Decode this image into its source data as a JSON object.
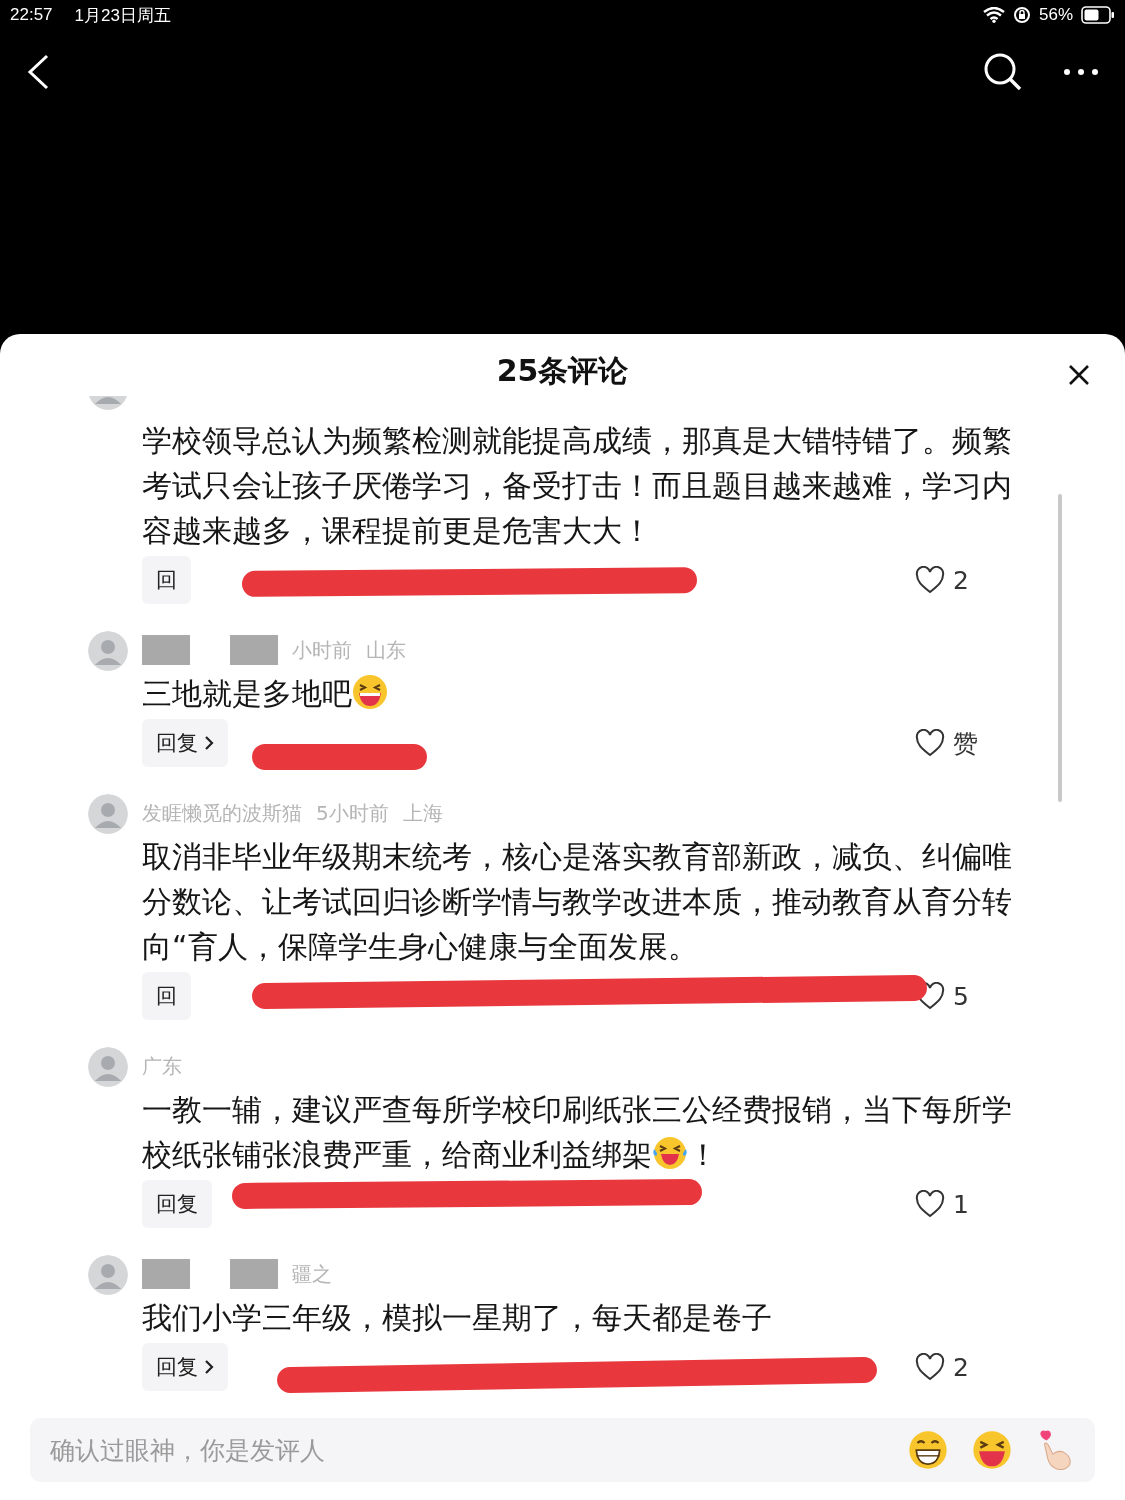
{
  "status_bar": {
    "time": "22:57",
    "date": "1月23日周五",
    "battery": "56%"
  },
  "sheet": {
    "title": "25条评论"
  },
  "comments": [
    {
      "name_hidden": false,
      "segments": [
        {
          "kind": "text",
          "text": "学校领导总认为频繁检测就能提高成绩，那真是大错特错了。频繁考试只会让孩子厌倦学习，备受打击！而且题目越来越难，学习内容越来越多，课程提前更是危害大大！"
        }
      ],
      "reply": "回",
      "chevron": false,
      "redacted": true,
      "likes": "2"
    },
    {
      "meta": [
        "小时前",
        "山东"
      ],
      "name_hidden": true,
      "segments": [
        {
          "kind": "text",
          "text": "三地就是多地吧"
        },
        {
          "kind": "laugh"
        }
      ],
      "reply": "回复",
      "chevron": true,
      "redacted": true,
      "likes": "赞"
    },
    {
      "meta": [
        "发睚懒觅的波斯猫",
        "5小时前",
        "上海"
      ],
      "name_hidden": false,
      "segments": [
        {
          "kind": "text",
          "text": "取消非毕业年级期末统考，核心是落实教育部新政，减负、纠偏唯分数论、让考试回归诊断学情与教学改进本质，推动教育从育分转向“育人，保障学生身心健康与全面发展。"
        }
      ],
      "reply": "回",
      "chevron": false,
      "redacted": true,
      "likes": "5"
    },
    {
      "meta": [
        "广东"
      ],
      "name_hidden": false,
      "segments": [
        {
          "kind": "text",
          "text": "一教一辅，建议严查每所学校印刷纸张三公经费报销，当下每所学"
        },
        {
          "kind": "break"
        },
        {
          "kind": "text",
          "text": "校纸张铺张浪费严重，给商业利益绑架"
        },
        {
          "kind": "tears"
        },
        {
          "kind": "text",
          "text": "！"
        }
      ],
      "reply": "回复",
      "chevron": false,
      "redacted": true,
      "likes": "1"
    },
    {
      "meta": [
        "疆之"
      ],
      "name_hidden": true,
      "segments": [
        {
          "kind": "text",
          "text": "我们小学三年级，模拟一星期了，每天都是卷子"
        }
      ],
      "reply": "回复",
      "chevron": true,
      "redacted": true,
      "likes": "2"
    }
  ],
  "input": {
    "placeholder": "确认过眼神，你是发评人"
  }
}
